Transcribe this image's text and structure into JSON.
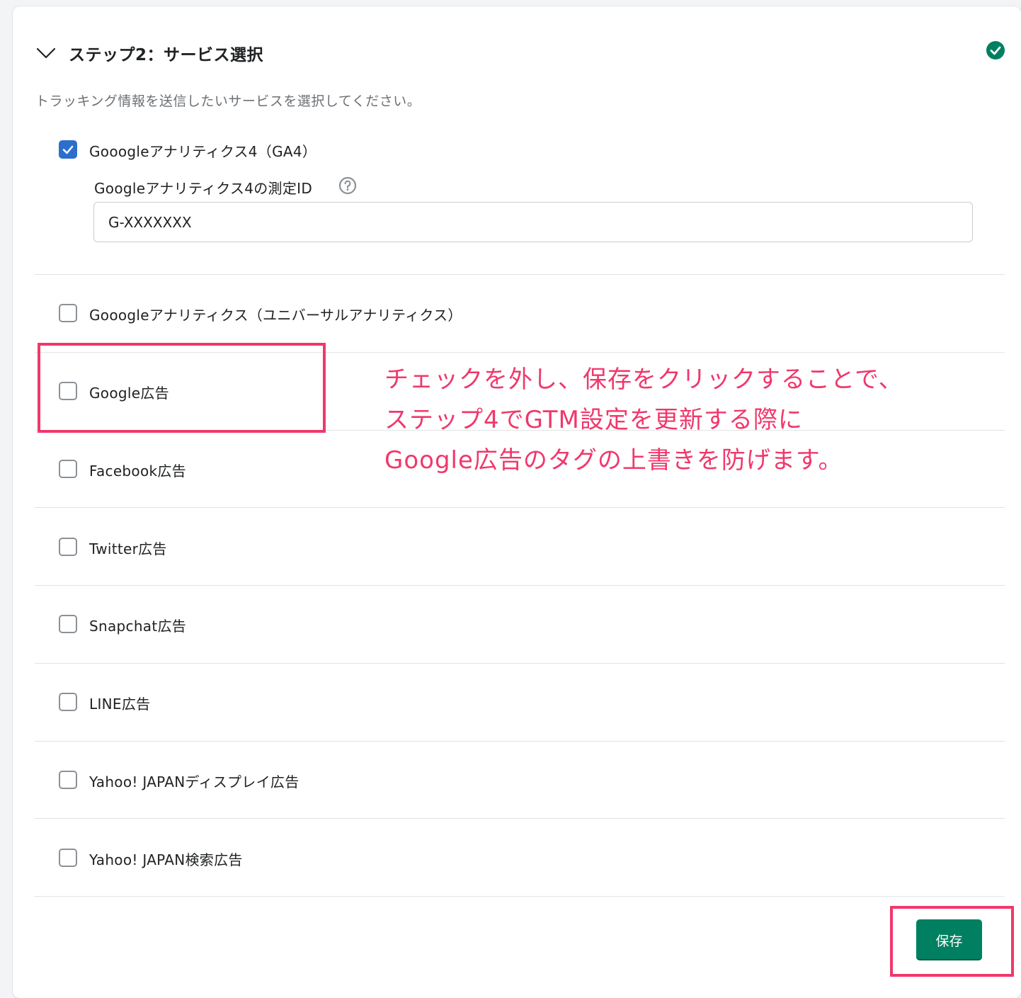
{
  "step": {
    "title": "ステップ2：サービス選択",
    "description": "トラッキング情報を送信したいサービスを選択してください。"
  },
  "services": [
    {
      "label": "Gooogleアナリティクス4（GA4）",
      "checked": true
    },
    {
      "label": "Gooogleアナリティクス（ユニバーサルアナリティクス）",
      "checked": false
    },
    {
      "label": "Google広告",
      "checked": false
    },
    {
      "label": "Facebook広告",
      "checked": false
    },
    {
      "label": "Twitter広告",
      "checked": false
    },
    {
      "label": "Snapchat広告",
      "checked": false
    },
    {
      "label": "LINE広告",
      "checked": false
    },
    {
      "label": "Yahoo! JAPANディスプレイ広告",
      "checked": false
    },
    {
      "label": "Yahoo! JAPAN検索広告",
      "checked": false
    }
  ],
  "ga4_field": {
    "label": "Googleアナリティクス4の測定ID",
    "value": "G-XXXXXXX"
  },
  "annotation": {
    "lines": [
      "チェックを外し、保存をクリックすることで、",
      "ステップ4でGTM設定を更新する際に",
      "Google広告のタグの上書きを防げます。"
    ]
  },
  "save_button": {
    "label": "保存"
  },
  "colors": {
    "primary": "#008060",
    "checkbox_checked": "#2c6ecb",
    "annotation": "#f0386b",
    "success": "#008060"
  }
}
